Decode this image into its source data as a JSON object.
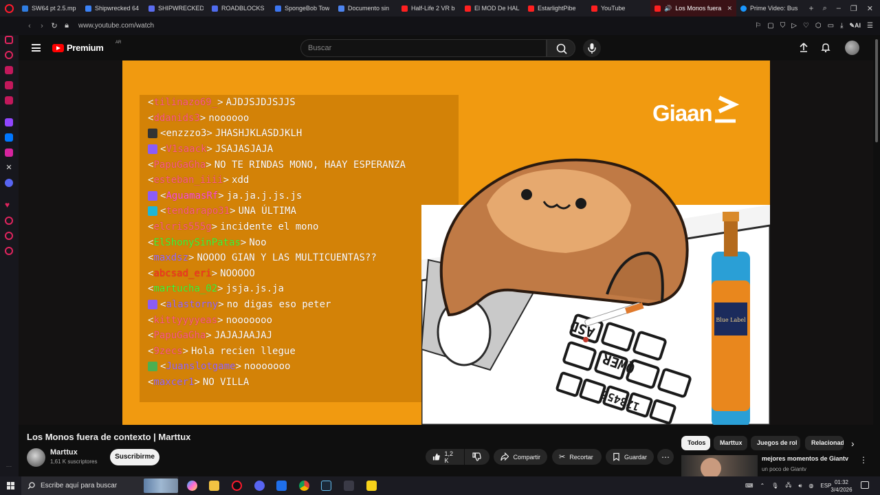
{
  "browser": {
    "tabs": [
      {
        "title": "SW64 pt 2.5.mp",
        "color": "#2f7de1"
      },
      {
        "title": "Shipwrecked 64",
        "color": "#3b82f6"
      },
      {
        "title": "SHIPWRECKED",
        "color": "#5b6df0"
      },
      {
        "title": "ROADBLOCKS",
        "color": "#4f6bed"
      },
      {
        "title": "SpongeBob Tow",
        "color": "#3c76f0"
      },
      {
        "title": "Documento sin",
        "color": "#4d84ef"
      },
      {
        "title": "Half-Life 2 VR b",
        "color": "#ff2020"
      },
      {
        "title": "El MOD De HAL",
        "color": "#ff2020"
      },
      {
        "title": "EstarlightPibe",
        "color": "#ff2020"
      },
      {
        "title": "YouTube",
        "color": "#ff2020"
      }
    ],
    "active_tab": {
      "title": "Los Monos fuera de co",
      "color": "#ff2020"
    },
    "next_tab": {
      "title": "Prime Video: Bus",
      "color": "#1a98ff"
    },
    "url": "www.youtube.com/watch",
    "ai_label": "AI"
  },
  "youtube": {
    "logo_text": "Premium",
    "country_code": "AR",
    "search_placeholder": "Buscar"
  },
  "video": {
    "watermark": "Giaan",
    "chat": [
      {
        "user": "tilinazo69_",
        "message": "AJDJSJDJSJJS",
        "badge": "",
        "user_color": "#ff5b8a"
      },
      {
        "user": "ddanids3",
        "message": "noooooo",
        "badge": "",
        "user_color": "#ff5b8a"
      },
      {
        "user": "enzzzo3",
        "message": "JHASHJKLASDJKLH",
        "badge": "speaker",
        "user_color": "#ffffff"
      },
      {
        "user": "V1saack",
        "message": "JSAJASJAJA",
        "badge": "sub",
        "user_color": "#ff5b8a"
      },
      {
        "user": "PapuGaGha",
        "message": "NO TE RINDAS MONO, HAAY ESPERANZA",
        "badge": "",
        "user_color": "#ff5b8a"
      },
      {
        "user": "esteban_iiii",
        "message": "xdd",
        "badge": "",
        "user_color": "#ff5b8a"
      },
      {
        "user": "AguamasRf",
        "message": "ja.ja.j.js.js",
        "badge": "sub",
        "user_color": "#ff4fe0"
      },
      {
        "user": "tendarapo31",
        "message": "UNA ÚLTIMA",
        "badge": "vip",
        "user_color": "#ff5b8a"
      },
      {
        "user": "elcris555g",
        "message": "incidente el mono",
        "badge": "",
        "user_color": "#ff5b8a"
      },
      {
        "user": "ElShonySinPatas",
        "message": "Noo",
        "badge": "",
        "user_color": "#3dff3d"
      },
      {
        "user": "maxdsz",
        "message": "NOOOO GIAN Y LAS MULTICUENTAS??",
        "badge": "",
        "user_color": "#9c6cff"
      },
      {
        "user": "abcsad_eri",
        "message": "NOOOOO",
        "badge": "",
        "user_color": "#ff2a2a"
      },
      {
        "user": "martucha_02",
        "message": "jsja.js.ja",
        "badge": "",
        "user_color": "#3dff3d"
      },
      {
        "user": "alastorny",
        "message": "no digas eso peter",
        "badge": "sub",
        "user_color": "#9c6cff"
      },
      {
        "user": "kittyyyyeas",
        "message": "nooooooo",
        "badge": "",
        "user_color": "#ff5b8a"
      },
      {
        "user": "PapuGaGha",
        "message": "JAJAJAAJAJ",
        "badge": "",
        "user_color": "#ff5b8a"
      },
      {
        "user": "9zecs",
        "message": "Hola recien llegue",
        "badge": "",
        "user_color": "#ff5b8a"
      },
      {
        "user": "Juanslotgame",
        "message": "nooooooo",
        "badge": "mod",
        "user_color": "#9c6cff"
      },
      {
        "user": "maxcer1",
        "message": "NO VILLA",
        "badge": "",
        "user_color": "#9c6cff"
      }
    ],
    "keyboard_rows": [
      "ASD",
      "QWER",
      "123456"
    ],
    "bottle_label": "Blue Label"
  },
  "watch": {
    "title": "Los Monos fuera de contexto | Marttux",
    "channel_name": "Marttux",
    "subscribers": "1,61 K suscriptores",
    "subscribe_label": "Suscribirme",
    "like_count": "1,2 K",
    "share_label": "Compartir",
    "clip_label": "Recortar",
    "save_label": "Guardar"
  },
  "chips": [
    {
      "label": "Todos",
      "active": true
    },
    {
      "label": "Marttux",
      "active": false
    },
    {
      "label": "Juegos de rol",
      "active": false
    },
    {
      "label": "Relacionado",
      "active": false
    }
  ],
  "recommendation": {
    "title": "mejores momentos de Giantv",
    "channel": "un poco de Giantv"
  },
  "taskbar": {
    "search_placeholder": "Escribe aquí para buscar",
    "language": "ESP",
    "time": "01:32",
    "date": "3/4/2026"
  }
}
